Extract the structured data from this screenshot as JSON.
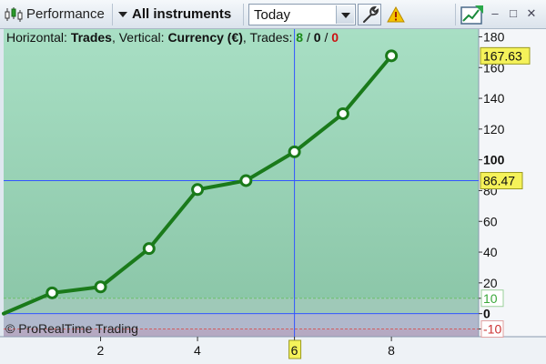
{
  "toolbar": {
    "title": "Performance",
    "instruments_label": "All instruments",
    "period_value": "Today",
    "buttons": {
      "minimize": "–",
      "restore": "□",
      "close": "✕"
    },
    "icons": [
      "candlestick-icon",
      "chevron-down-icon",
      "wrench-icon",
      "warning-icon",
      "chart-export-icon"
    ]
  },
  "info": {
    "horizontal_label": "Horizontal:",
    "horizontal_value": "Trades",
    "vertical_label": "Vertical:",
    "vertical_value": "Currency (€)",
    "trades_label": "Trades:",
    "trades_won": "8",
    "trades_neutral": "0",
    "trades_lost": "0",
    "separator": "/"
  },
  "watermark": "© ProRealTime Trading",
  "crosshair": {
    "x_value": 6,
    "x_label": "6",
    "y_value": 86.47,
    "y_label": "86.47"
  },
  "last_value_label": "167.63",
  "colors": {
    "line": "#1a7a1a",
    "profit_zone_top": "#a8dfc4",
    "profit_zone_bottom": "#8cc7a9",
    "loss_zone": "#b5a9c2",
    "crosshair": "#3355ff",
    "tag_bg": "#f5f25a"
  },
  "chart_data": {
    "type": "line",
    "x": [
      0,
      1,
      2,
      3,
      4,
      5,
      6,
      7,
      8
    ],
    "values": [
      0,
      13.5,
      17.4,
      42.3,
      80.7,
      86.5,
      105.2,
      130.0,
      167.63
    ],
    "markers": [
      1,
      2,
      3,
      4,
      5,
      6,
      7,
      8
    ],
    "xlim": [
      0,
      9.8
    ],
    "ylim": [
      -15,
      185
    ],
    "x_ticks": [
      "2",
      "4",
      "6",
      "8"
    ],
    "y_ticks": [
      "180",
      "160",
      "140",
      "120",
      "100",
      "80",
      "60",
      "40",
      "20",
      "10",
      "0",
      "-10"
    ],
    "threshold_upper": 10,
    "threshold_lower": -10,
    "grid": false
  }
}
